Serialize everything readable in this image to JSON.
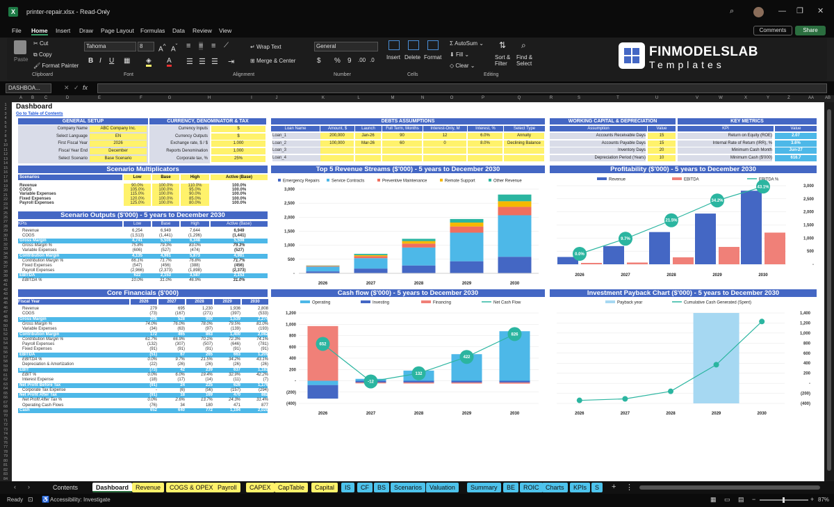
{
  "window": {
    "title": "printer-repair.xlsx  -  Read-Only",
    "comments": "Comments",
    "share": "Share"
  },
  "menu": [
    "File",
    "Home",
    "Insert",
    "Draw",
    "Page Layout",
    "Formulas",
    "Data",
    "Review",
    "View"
  ],
  "ribbon": {
    "paste": "Paste",
    "cut": "Cut",
    "copy": "Copy",
    "format_painter": "Format Painter",
    "clipboard": "Clipboard",
    "font_name": "Tahoma",
    "font_size": "8",
    "font": "Font",
    "wrap": "Wrap Text",
    "merge": "Merge & Center",
    "alignment": "Alignment",
    "number_format": "General",
    "number": "Number",
    "insert": "Insert",
    "delete": "Delete",
    "format": "Format",
    "cells": "Cells",
    "autosum": "AutoSum",
    "fill": "Fill",
    "clear": "Clear",
    "sort": "Sort & Filter",
    "find": "Find & Select",
    "editing": "Editing",
    "brand1": "FINMODELSLAB",
    "brand2": "Templates"
  },
  "formula": {
    "namebox": "DASHBOA...",
    "fx": "fx"
  },
  "columns": [
    "A",
    "B",
    "C",
    "D",
    "E",
    "F",
    "G",
    "H",
    "I",
    "J",
    "K",
    "L",
    "M",
    "N",
    "O",
    "P",
    "Q",
    "R",
    "S",
    "T",
    "U",
    "V",
    "W",
    "X",
    "Y",
    "Z",
    "AA",
    "AB",
    "AC",
    "AD",
    "AE",
    "AF"
  ],
  "dash": {
    "title": "Dashboard",
    "link": "Go to Table of Contents"
  },
  "general": {
    "header": "GENERAL SETUP",
    "rows": [
      [
        "Company Name",
        "ABC Company Inc."
      ],
      [
        "Select Language",
        "EN"
      ],
      [
        "First Fiscal Year",
        "2026"
      ],
      [
        "Fiscal Year End",
        "December"
      ],
      [
        "Select Scenario",
        "Base Scenario"
      ]
    ]
  },
  "currency": {
    "header": "CURRENCY, DENOMINATOR & TAX",
    "rows": [
      [
        "Currency Inputs",
        "$"
      ],
      [
        "Currency Outputs",
        "$"
      ],
      [
        "Exchange rate, $ / $",
        "1.000"
      ],
      [
        "Reports Denomination",
        "1,000"
      ],
      [
        "Corporate tax, %",
        "25%"
      ]
    ]
  },
  "debts": {
    "header": "DEBTS ASSUMPTIONS",
    "cols": [
      "Loan Name",
      "Amount, $",
      "Launch",
      "Full Term, Months",
      "Interest-Only, M",
      "Interest, %",
      "Select Type"
    ],
    "rows": [
      [
        "Loan_1",
        "200,000",
        "Jan-26",
        "90",
        "12",
        "6.0%",
        "Annuity"
      ],
      [
        "Loan_2",
        "100,000",
        "Mar-26",
        "60",
        "0",
        "8.0%",
        "Declining Balance"
      ],
      [
        "Loan_3",
        "",
        "",
        "",
        "",
        "",
        ""
      ],
      [
        "Loan_4",
        "",
        "",
        "",
        "",
        "",
        ""
      ]
    ]
  },
  "wc": {
    "header": "WORKING CAPITAL & DEPRECIATION",
    "cols": [
      "Assumption",
      "Value"
    ],
    "rows": [
      [
        "Accounts Receivable Days",
        "15"
      ],
      [
        "Accounts Payable Days",
        "15"
      ],
      [
        "Inventory Days",
        "20"
      ],
      [
        "Depreciation Period (Years)",
        "10"
      ]
    ]
  },
  "kpi": {
    "header": "KEY METRICS",
    "cols": [
      "KPI",
      "Value"
    ],
    "rows": [
      [
        "Return on Equity (ROE)",
        "2.07"
      ],
      [
        "Internal Rate of Return (IRR), %",
        "3.6%"
      ],
      [
        "Minimum Cash Month",
        "Jun-27"
      ],
      [
        "Minimum Cash ($'000)",
        "616.7"
      ]
    ]
  },
  "multipliers": {
    "header": "Scenario Multiplicators",
    "cols": [
      "Scenarios",
      "Low",
      "Base",
      "High",
      "Active (Base)"
    ],
    "rows": [
      [
        "Revenue",
        "90.0%",
        "100.0%",
        "110.0%",
        "100.0%"
      ],
      [
        "COGS",
        "105.0%",
        "100.0%",
        "95.0%",
        "100.0%"
      ],
      [
        "Variable Expenses",
        "115.0%",
        "100.0%",
        "90.0%",
        "100.0%"
      ],
      [
        "Fixed Expenses",
        "120.0%",
        "100.0%",
        "85.0%",
        "100.0%"
      ],
      [
        "Payroll Expenses",
        "125.0%",
        "100.0%",
        "80.0%",
        "100.0%"
      ]
    ]
  },
  "outputs": {
    "header": "Scenario Outputs ($'000) - 5 years to December 2030",
    "cols": [
      "KPIs",
      "Low",
      "Base",
      "High",
      "Active (Base)"
    ],
    "rows": [
      [
        "Revenue",
        "6,254",
        "6,949",
        "7,644",
        "6,949"
      ],
      [
        "COGS",
        "(1,513)",
        "(1,441)",
        "(1,296)",
        "(1,441)"
      ],
      [
        "Gross Margin",
        "4,741",
        "5,508",
        "6,348",
        "5,508"
      ],
      [
        "Gross Margin %",
        "75.8%",
        "79.3%",
        "83.0%",
        "79.3%"
      ],
      [
        "Variable Expenses",
        "(606)",
        "(527)",
        "(474)",
        "(527)"
      ],
      [
        "Contribution Margin",
        "4,135",
        "4,981",
        "5,873",
        "4,981"
      ],
      [
        "Contribution Margin %",
        "66.1%",
        "71.7%",
        "76.8%",
        "71.7%"
      ],
      [
        "Fixed Expenses",
        "(547)",
        "(456)",
        "(388)",
        "(456)"
      ],
      [
        "Payroll Expenses",
        "(2,966)",
        "(2,373)",
        "(1,898)",
        "(2,373)"
      ],
      [
        "EBITDA",
        "622",
        "2,153",
        "3,587",
        "2,153"
      ],
      [
        "EBITDA %",
        "10.0%",
        "31.0%",
        "46.9%",
        "31.0%"
      ]
    ]
  },
  "core": {
    "header": "Core Financials ($'000)",
    "cols": [
      "Fiscal Year",
      "2026",
      "2027",
      "2028",
      "2029",
      "2030"
    ],
    "rows": [
      [
        "Revenue",
        "279",
        "695",
        "1,230",
        "1,936",
        "2,808"
      ],
      [
        "COGS",
        "(73)",
        "(167)",
        "(271)",
        "(397)",
        "(533)"
      ],
      [
        "Gross Margin",
        "206",
        "528",
        "960",
        "1,539",
        "2,274"
      ],
      [
        "Gross Margin %",
        "74.0%",
        "76.0%",
        "78.0%",
        "79.5%",
        "81.0%"
      ],
      [
        "Variable Expenses",
        "(34)",
        "(63)",
        "(97)",
        "(139)",
        "(193)"
      ],
      [
        "Contribution Margin",
        "172",
        "465",
        "863",
        "1,400",
        "2,082"
      ],
      [
        "Contribution Margin %",
        "61.7%",
        "66.9%",
        "70.1%",
        "72.3%",
        "74.1%"
      ],
      [
        "Payroll Expenses",
        "(132)",
        "(307)",
        "(507)",
        "(646)",
        "(781)"
      ],
      [
        "Fixed Expenses",
        "(91)",
        "(91)",
        "(91)",
        "(91)",
        "(91)"
      ],
      [
        "EBITDA",
        "(51)",
        "67",
        "265",
        "663",
        "1,209"
      ],
      [
        "EBITDA %",
        "0.0%",
        "9.7%",
        "21.5%",
        "34.2%",
        "43.1%"
      ],
      [
        "Depreciation & Amortization",
        "(22)",
        "(26)",
        "(26)",
        "(26)",
        "(26)"
      ],
      [
        "EBIT",
        "(73)",
        "42",
        "239",
        "637",
        "1,183"
      ],
      [
        "EBIT %",
        "0.0%",
        "6.0%",
        "19.4%",
        "32.9%",
        "42.2%"
      ],
      [
        "Interest Expense",
        "(18)",
        "(17)",
        "(14)",
        "(11)",
        "(7)"
      ],
      [
        "Net Profit Before Tax",
        "(91)",
        "24",
        "225",
        "626",
        "1,176"
      ],
      [
        "Corporate Tax Expense",
        "-",
        "(6)",
        "(56)",
        "(157)",
        "(294)"
      ],
      [
        "Net Profit After Tax",
        "(91)",
        "18",
        "169",
        "470",
        "882"
      ],
      [
        "Net Profit After Tax %",
        "0.0%",
        "2.6%",
        "13.7%",
        "24.3%",
        "31.4%"
      ],
      [
        "Operating Cash Flows",
        "(76)",
        "34",
        "180",
        "471",
        "877"
      ],
      [
        "Cash",
        "652",
        "640",
        "772",
        "1,194",
        "2,020"
      ]
    ]
  },
  "chart_data": [
    {
      "type": "bar",
      "title": "Top 5 Revenue Streams ($'000) - 5 years to December 2030",
      "categories": [
        "2026",
        "2027",
        "2028",
        "2029",
        "2030"
      ],
      "series": [
        {
          "name": "Emergency Repairs",
          "values": [
            70,
            170,
            280,
            430,
            590
          ]
        },
        {
          "name": "Service Contracts",
          "values": [
            170,
            370,
            640,
            1020,
            1480
          ]
        },
        {
          "name": "Preventive Maintenance",
          "values": [
            20,
            70,
            140,
            220,
            300
          ]
        },
        {
          "name": "Remote Support",
          "values": [
            10,
            40,
            90,
            140,
            200
          ]
        },
        {
          "name": "Other Revenue",
          "values": [
            9,
            45,
            80,
            126,
            238
          ]
        }
      ],
      "yticks": [
        "3,000",
        "2,500",
        "2,000",
        "1,500",
        "1,000",
        "500",
        "-"
      ],
      "ylim": [
        0,
        3000
      ]
    },
    {
      "type": "bar+line",
      "title": "Profitability ($'000) - 5 years to December 2030",
      "categories": [
        "2026",
        "2027",
        "2028",
        "2029",
        "2030"
      ],
      "series": [
        {
          "name": "Revenue",
          "values": [
            279,
            695,
            1230,
            1936,
            2808
          ]
        },
        {
          "name": "EBITDA",
          "values": [
            -51,
            67,
            265,
            663,
            1209
          ]
        },
        {
          "name": "EBITDA %",
          "values": [
            0.0,
            9.7,
            21.5,
            34.2,
            43.1
          ]
        }
      ],
      "labels": [
        "0.0%",
        "9.7%",
        "21.5%",
        "34.2%",
        "43.1%"
      ],
      "yticks": [
        "3,000",
        "2,500",
        "2,000",
        "1,500",
        "1,000",
        "500",
        "-"
      ],
      "ylim": [
        0,
        3000
      ]
    },
    {
      "type": "bar+line",
      "title": "Cash flow ($'000) - 5 years to December 2030",
      "categories": [
        "2026",
        "2027",
        "2028",
        "2029",
        "2030"
      ],
      "series": [
        {
          "name": "Operating",
          "values": [
            -76,
            34,
            180,
            471,
            877
          ]
        },
        {
          "name": "Investing",
          "values": [
            -240,
            -30,
            -30,
            -30,
            -30
          ]
        },
        {
          "name": "Financing",
          "values": [
            968,
            -16,
            -18,
            -19,
            -21
          ]
        },
        {
          "name": "Net Cash Flow",
          "values": [
            652,
            -12,
            132,
            422,
            826
          ]
        }
      ],
      "labels": [
        "652",
        "-12",
        "132",
        "422",
        "826"
      ],
      "yticks": [
        "1,200",
        "1,000",
        "800",
        "600",
        "400",
        "200",
        "-",
        "(200)",
        "(400)"
      ],
      "ylim": [
        -400,
        1200
      ]
    },
    {
      "type": "bar+line",
      "title": "Investment Payback Chart ($'000) - 5 years to December 2030",
      "categories": [
        "2026",
        "2027",
        "2028",
        "2029",
        "2030"
      ],
      "series": [
        {
          "name": "Payback year",
          "values": [
            0,
            0,
            0,
            1,
            0
          ]
        },
        {
          "name": "Cumulative Cash Generated (Spent)",
          "values": [
            -340,
            -310,
            -160,
            370,
            1230
          ]
        }
      ],
      "yticks": [
        "1,400",
        "1,200",
        "1,000",
        "800",
        "600",
        "400",
        "200",
        "-",
        "(200)",
        "(400)"
      ],
      "ylim": [
        -400,
        1400
      ]
    }
  ],
  "sheets": [
    "Contents",
    "Dashboard",
    "Revenue",
    "COGS & OPEX",
    "Payroll",
    "CAPEX",
    "CapTable",
    "Capital",
    "IS",
    "CF",
    "BS",
    "Scenarios",
    "Valuation",
    "Summary",
    "BE",
    "ROIC",
    "Charts",
    "KPIs",
    "S"
  ],
  "status": {
    "ready": "Ready",
    "access": "Accessibility: Investigate",
    "zoom": "87%"
  },
  "colors": {
    "blue": "#4467c4",
    "cyan": "#4db8e8",
    "red": "#f08078",
    "teal": "#2bb5a0",
    "yellow": "#fff26b"
  }
}
